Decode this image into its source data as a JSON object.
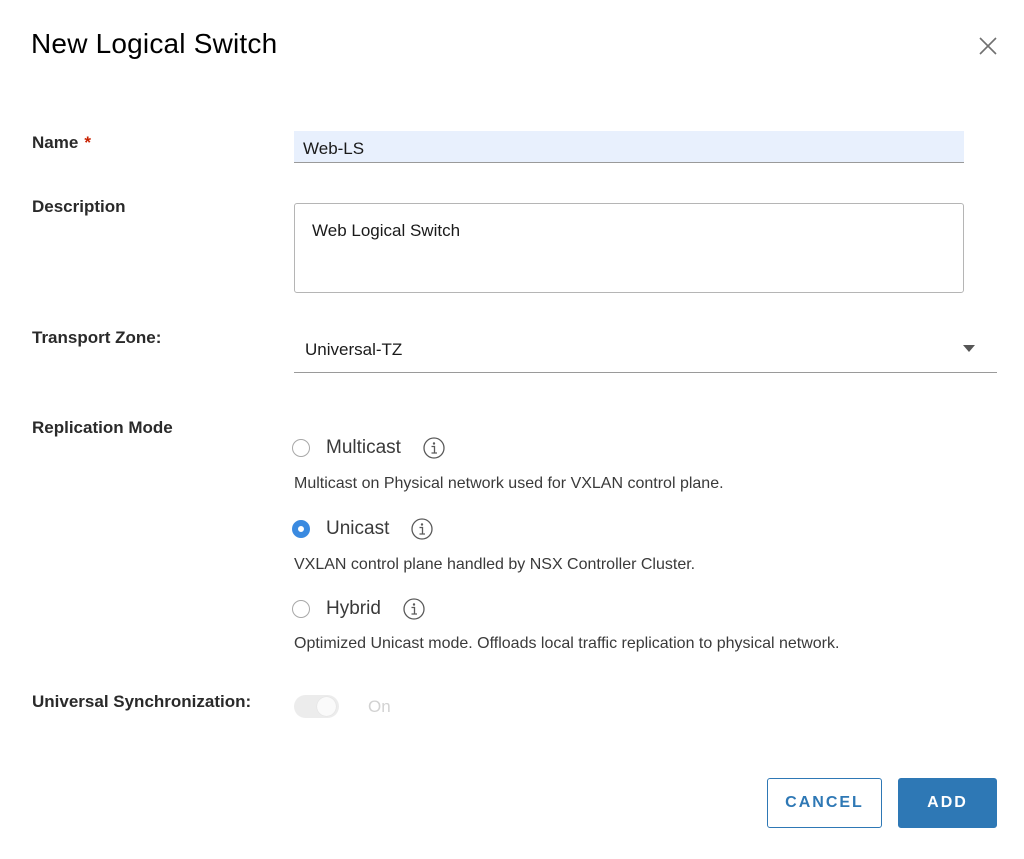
{
  "dialog": {
    "title": "New Logical Switch",
    "close_icon": "close-icon"
  },
  "form": {
    "name": {
      "label": "Name",
      "required_mark": "*",
      "value": "Web-LS"
    },
    "description": {
      "label": "Description",
      "value": "Web Logical Switch"
    },
    "transport_zone": {
      "label": "Transport Zone:",
      "selected": "Universal-TZ",
      "icon": "chevron-down-icon"
    },
    "replication_mode": {
      "label": "Replication Mode",
      "options": [
        {
          "label": "Multicast",
          "checked": false,
          "description": "Multicast on Physical network used for VXLAN control plane."
        },
        {
          "label": "Unicast",
          "checked": true,
          "description": "VXLAN control plane handled by NSX Controller Cluster."
        },
        {
          "label": "Hybrid",
          "checked": false,
          "description": "Optimized Unicast mode. Offloads local traffic replication to physical network."
        }
      ]
    },
    "universal_sync": {
      "label": "Universal Synchronization:",
      "state_label": "On",
      "enabled": true,
      "disabled": true
    }
  },
  "buttons": {
    "cancel": "CANCEL",
    "add": "ADD"
  },
  "colors": {
    "accent": "#2e78b5",
    "radio_checked": "#3a8ae0",
    "required": "#c92100",
    "name_field_bg": "#e8f0fd"
  }
}
